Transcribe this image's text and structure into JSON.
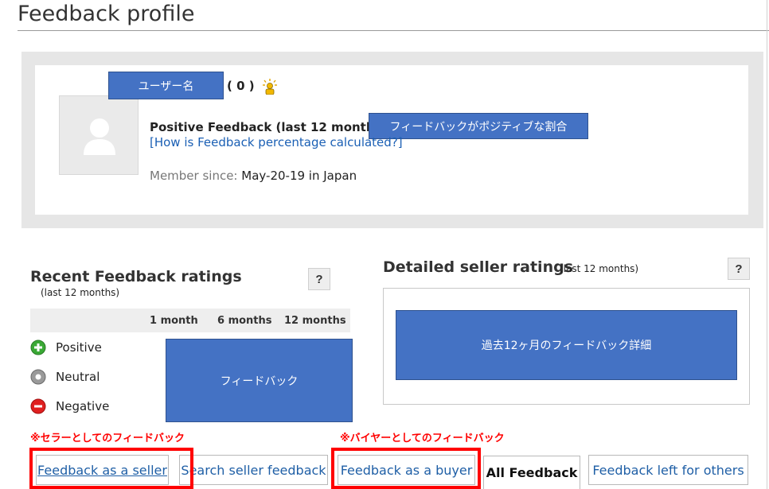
{
  "page": {
    "title": "Feedback profile"
  },
  "profile": {
    "username_label": "ユーザー名",
    "score": "( 0 )",
    "positive_label": "Positive Feedback (last 12 months):",
    "positive_box": "フィードバックがポジティブな割合",
    "how_link": "[How is Feedback percentage calculated?]",
    "member_since_label": "Member since:",
    "member_since_value": "May-20-19 in Japan"
  },
  "recent": {
    "title": "Recent Feedback ratings",
    "subtitle": "(last 12 months)",
    "help": "?",
    "columns": [
      "1 month",
      "6 months",
      "12 months"
    ],
    "rows": [
      "Positive",
      "Neutral",
      "Negative"
    ],
    "box_label": "フィードバック"
  },
  "detailed": {
    "title": "Detailed seller ratings",
    "subtitle": "(last 12 months)",
    "help": "?",
    "box_label": "過去12ヶ月のフィードバック詳細"
  },
  "notes": {
    "seller": "※セラーとしてのフィードバック",
    "buyer": "※バイヤーとしてのフィードバック"
  },
  "tabs": [
    {
      "label": "Feedback as a seller"
    },
    {
      "label": "Search seller feedback"
    },
    {
      "label": "Feedback as a buyer"
    },
    {
      "label": "All Feedback"
    },
    {
      "label": "Feedback left for others"
    }
  ],
  "colors": {
    "annotation_blue": "#4472c4",
    "highlight_red": "#ff0000",
    "positive": "#3aa935",
    "neutral": "#9a9a9a",
    "negative": "#e02020"
  }
}
